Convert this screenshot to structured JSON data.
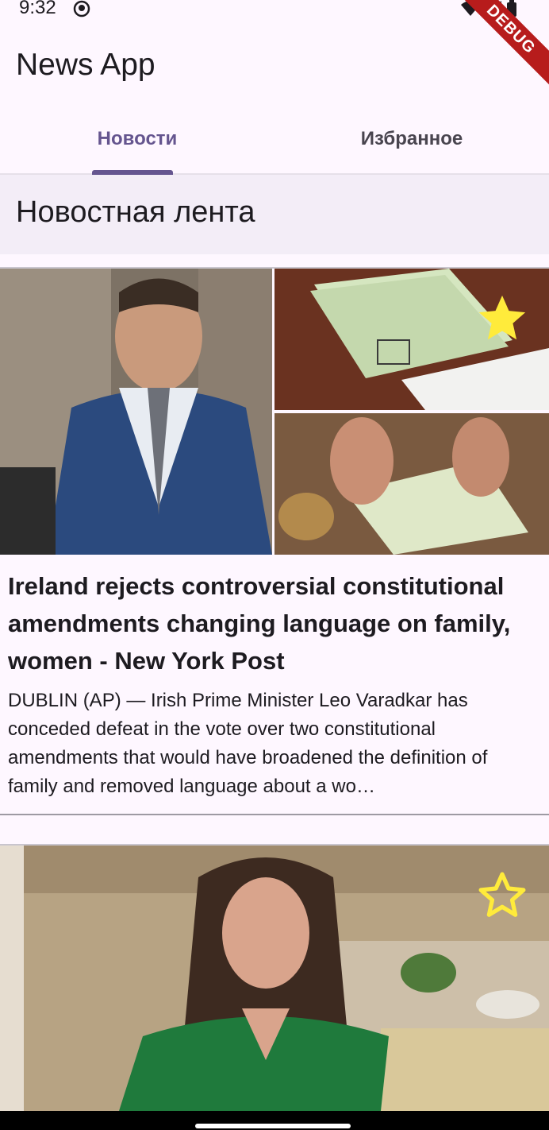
{
  "status_bar": {
    "time": "9:32",
    "icons": [
      "app-notification-icon",
      "wifi-icon",
      "signal-icon",
      "battery-icon"
    ]
  },
  "debug_banner": "DEBUG",
  "app_bar": {
    "title": "News App"
  },
  "tabs": [
    {
      "label": "Новости",
      "active": true
    },
    {
      "label": "Избранное",
      "active": false
    }
  ],
  "section": {
    "title": "Новостная лента"
  },
  "articles": [
    {
      "title": "Ireland rejects controversial constitutional amendments changing language on family, women - New York Post",
      "description": "DUBLIN (AP) — Irish Prime Minister Leo Varadkar has conceded defeat in the vote over two constitutional amendments that would have broadened the definition of family and removed language about a wo…",
      "favorite": true,
      "favorite_icon": "star-filled-icon"
    },
    {
      "title": "",
      "description": "",
      "favorite": false,
      "favorite_icon": "star-outline-icon"
    }
  ],
  "colors": {
    "primary": "#65558F",
    "background": "#FEF7FF",
    "section_bg": "#F3EDF7",
    "star": "#FFEB3B",
    "debug": "#B71C1C"
  }
}
